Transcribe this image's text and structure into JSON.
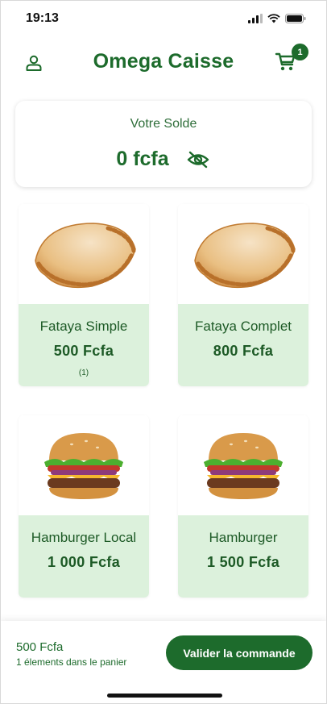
{
  "status_bar": {
    "time": "19:13"
  },
  "header": {
    "title": "Omega Caisse",
    "cart_badge_count": "1",
    "user_icon": "user-icon",
    "cart_icon": "cart-icon"
  },
  "balance": {
    "label": "Votre Solde",
    "value": "0 fcfa",
    "toggle_icon": "eye-off-icon"
  },
  "products": [
    {
      "name": "Fataya Simple",
      "price": "500 Fcfa",
      "quantity": "(1)",
      "image": "fataya-image"
    },
    {
      "name": "Fataya Complet",
      "price": "800 Fcfa",
      "quantity": "",
      "image": "fataya-image"
    },
    {
      "name": "Hamburger Local",
      "price": "1 000 Fcfa",
      "quantity": "",
      "image": "hamburger-image"
    },
    {
      "name": "Hamburger",
      "price": "1 500 Fcfa",
      "quantity": "",
      "image": "hamburger-image"
    }
  ],
  "cart_summary": {
    "total": "500 Fcfa",
    "count_label": "1 élements dans le panier",
    "validate_label": "Valider la commande"
  },
  "colors": {
    "brand": "#1d6b2c",
    "card_info_bg": "#dcf1dc"
  }
}
